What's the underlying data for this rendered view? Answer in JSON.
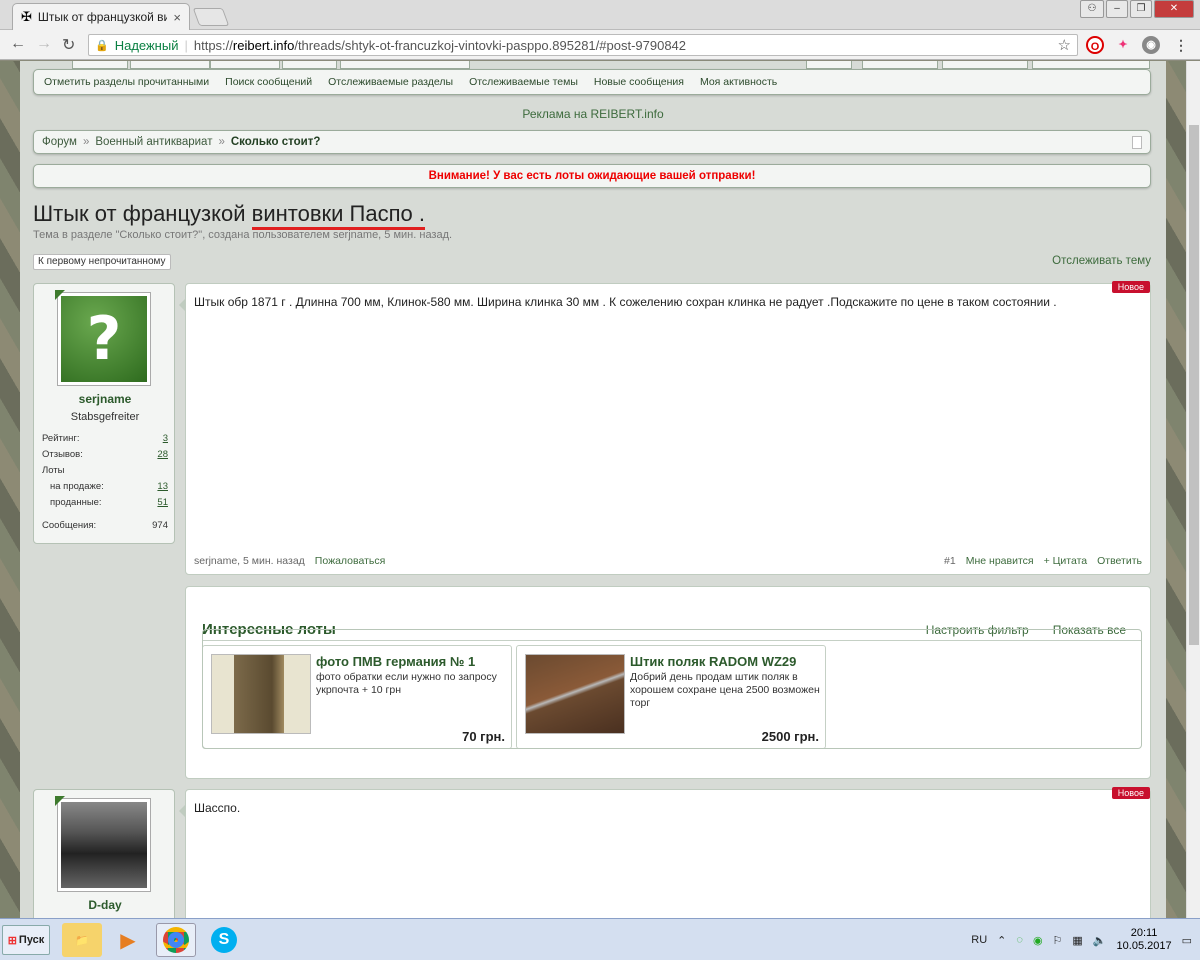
{
  "browser": {
    "tab_title": "Штык от французкой ви",
    "address_secure_label": "Надежный",
    "address_scheme": "https://",
    "address_host": "reibert.info",
    "address_path": "/threads/shtyk-ot-francuzkoj-vintovki-pasppo.895281/#post-9790842"
  },
  "quicklinks": [
    "Отметить разделы прочитанными",
    "Поиск сообщений",
    "Отслеживаемые разделы",
    "Отслеживаемые темы",
    "Новые сообщения",
    "Моя активность"
  ],
  "ad_text": "Реклама на REIBERT.info",
  "breadcrumb": {
    "forum": "Форум",
    "section": "Военный антиквариат",
    "current": "Сколько стоит?",
    "sep": "»"
  },
  "alert": "Внимание! У вас есть лоты ожидающие вашей отправки!",
  "thread": {
    "title_plain": "Штык от французкой ",
    "title_underlined": "винтовки Паспо .",
    "subtitle": "Тема в разделе \"Сколько стоит?\", создана пользователем serjname, 5 мин. назад.",
    "first_unread": "К первому непрочитанному",
    "watch": "Отслеживать тему"
  },
  "post1": {
    "badge": "Новое",
    "user": "serjname",
    "rank": "Stabsgefreiter",
    "stats": {
      "rating_label": "Рейтинг:",
      "rating": "3",
      "reviews_label": "Отзывов:",
      "reviews": "28",
      "lots_label": "Лоты",
      "selling_label": "на продаже:",
      "selling": "13",
      "sold_label": "проданные:",
      "sold": "51",
      "messages_label": "Сообщения:",
      "messages": "974"
    },
    "text": "Штык обр 1871 г . Длинна 700 мм, Клинок-580 мм. Ширина клинка 30 мм . К сожелению сохран клинка не радует .Подскажите по цене в таком состоянии .",
    "meta": "serjname, 5 мин. назад",
    "report": "Пожаловаться",
    "num": "#1",
    "like": "Мне нравится",
    "quote": "+ Цитата",
    "reply": "Ответить"
  },
  "lots": {
    "heading": "Интересные лоты",
    "filter": "Настроить фильтр",
    "show_all": "Показать все",
    "items": [
      {
        "title": "фото ПМВ германия № 1",
        "desc": "фото обратки если нужно по запросу укрпочта + 10 грн",
        "price": "70 грн."
      },
      {
        "title": "Штик поляк RADOM WZ29",
        "desc": "Добрий день продам штик поляк в хорошем сохране цена 2500 возможен торг",
        "price": "2500 грн."
      }
    ]
  },
  "post2": {
    "badge": "Новое",
    "user": "D-day",
    "text": "Шасспо."
  },
  "taskbar": {
    "start": "Пуск",
    "lang": "RU",
    "time": "20:11",
    "date": "10.05.2017"
  }
}
